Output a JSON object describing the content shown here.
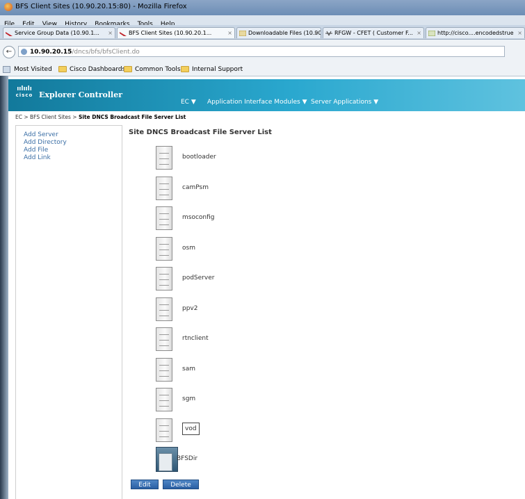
{
  "window": {
    "title": "BFS Client Sites (10.90.20.15:80) - Mozilla Firefox"
  },
  "menu": [
    "File",
    "Edit",
    "View",
    "History",
    "Bookmarks",
    "Tools",
    "Help"
  ],
  "tabs": [
    {
      "label": "Service Group Data (10.90.1...",
      "close": "×"
    },
    {
      "label": "BFS Client Sites (10.90.20.1...",
      "close": "×"
    },
    {
      "label": "Downloadable Files (10.90....",
      "close": "×"
    },
    {
      "label": "RFGW - CFET ( Customer F...",
      "close": "×"
    },
    {
      "label": "http://cisco....encodedstrue",
      "close": "×"
    }
  ],
  "nav": {
    "back": "←",
    "host": "10.90.20.15",
    "path": "/dncs/bfs/bfsClient.do"
  },
  "bookmarks": [
    "Most Visited",
    "Cisco Dashboards",
    "Common Tools",
    "Internal Support"
  ],
  "app": {
    "logo": "cisco",
    "title": "Explorer Controller",
    "nav": [
      "EC ▼",
      "Application Interface Modules ▼",
      "Server Applications ▼"
    ]
  },
  "breadcrumb": {
    "part1": "EC > BFS Client Sites > ",
    "current": "Site DNCS Broadcast File Server List"
  },
  "left_actions": [
    "Add Server",
    "Add Directory",
    "Add File",
    "Add Link"
  ],
  "main": {
    "title": "Site DNCS Broadcast File Server List",
    "servers": [
      "bootloader",
      "camPsm",
      "msoconfig",
      "osm",
      "podServer",
      "ppv2",
      "rtnclient",
      "sam",
      "sgm",
      "vod"
    ],
    "selected": "vod",
    "directory": "BFSDir",
    "edit_label": "Edit",
    "delete_label": "Delete"
  }
}
